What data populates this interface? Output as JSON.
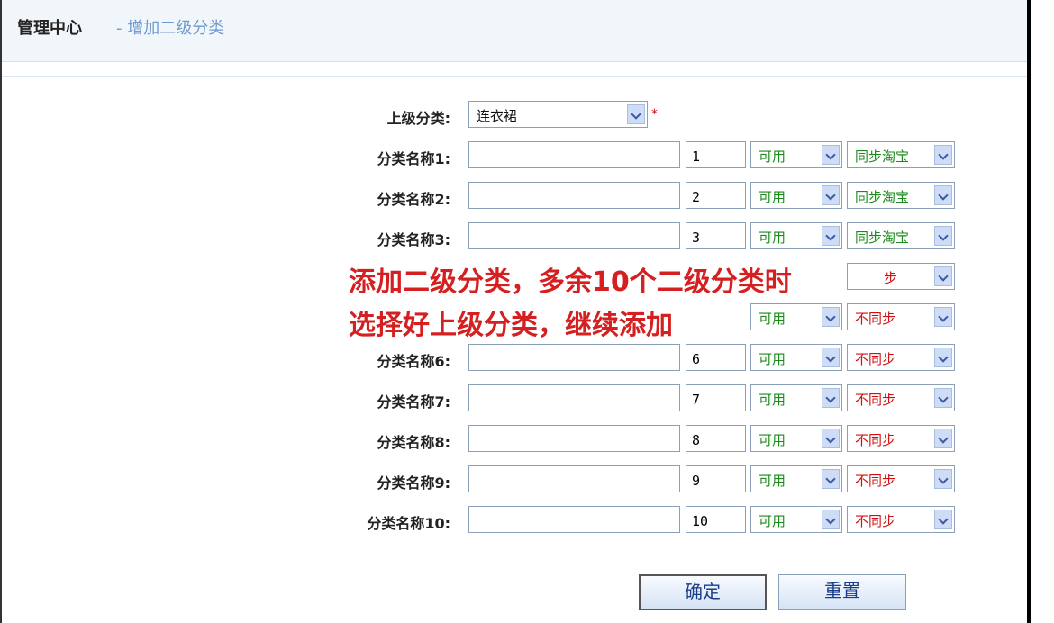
{
  "header": {
    "title": "管理中心",
    "subtitle": "- 增加二级分类"
  },
  "form": {
    "parent_label": "上级分类:",
    "parent_value": "连衣裙",
    "required_mark": "*",
    "rows": [
      {
        "label": "分类名称1:",
        "order": "1",
        "status": "可用",
        "sync": "同步淘宝"
      },
      {
        "label": "分类名称2:",
        "order": "2",
        "status": "可用",
        "sync": "同步淘宝"
      },
      {
        "label": "分类名称3:",
        "order": "3",
        "status": "可用",
        "sync": "同步淘宝"
      },
      {
        "label": "分类名称6:",
        "order": "6",
        "status": "可用",
        "sync": "不同步"
      },
      {
        "label": "分类名称7:",
        "order": "7",
        "status": "可用",
        "sync": "不同步"
      },
      {
        "label": "分类名称8:",
        "order": "8",
        "status": "可用",
        "sync": "不同步"
      },
      {
        "label": "分类名称9:",
        "order": "9",
        "status": "可用",
        "sync": "不同步"
      },
      {
        "label": "分类名称10:",
        "order": "10",
        "status": "可用",
        "sync": "不同步"
      }
    ],
    "row4_sync_partial": "步",
    "row5_status": "可用",
    "row5_sync": "不同步"
  },
  "annotation": {
    "line1": "添加二级分类，多余10个二级分类时",
    "line2": "选择好上级分类，继续添加"
  },
  "buttons": {
    "confirm": "确定",
    "reset": "重置"
  }
}
